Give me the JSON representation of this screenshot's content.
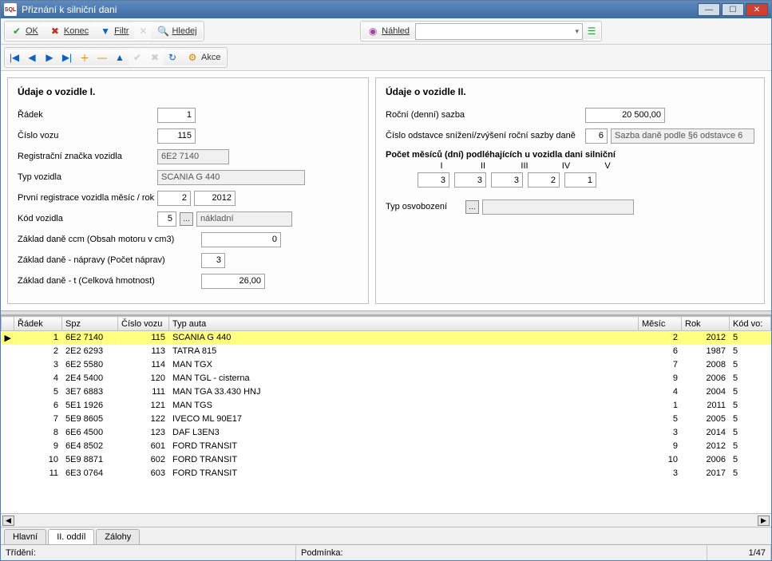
{
  "window": {
    "title": "Přiznání k silniční dani",
    "app_icon_text": "SQL"
  },
  "toolbar1": {
    "ok": "OK",
    "konec": "Konec",
    "filtr": "Filtr",
    "hledej": "Hledej",
    "nahled": "Náhled"
  },
  "toolbar2": {
    "akce": "Akce"
  },
  "panel1": {
    "heading": "Údaje o vozidle I.",
    "radek_label": "Řádek",
    "radek_value": "1",
    "cislo_vozu_label": "Číslo vozu",
    "cislo_vozu_value": "115",
    "spz_label": "Registrační značka vozidla",
    "spz_value": "6E2 7140",
    "typ_label": "Typ vozidla",
    "typ_value": "SCANIA G 440",
    "prvni_reg_label": "První registrace vozidla měsíc / rok",
    "prvni_reg_mesic": "2",
    "prvni_reg_rok": "2012",
    "kod_label": "Kód vozidla",
    "kod_value": "5",
    "kod_text": "nákladní",
    "zaklad_ccm_label": "Základ daně ccm (Obsah motoru v cm3)",
    "zaklad_ccm_value": "0",
    "zaklad_napravy_label": "Základ daně - nápravy (Počet náprav)",
    "zaklad_napravy_value": "3",
    "zaklad_t_label": "Základ daně - t (Celková hmotnost)",
    "zaklad_t_value": "26,00"
  },
  "panel2": {
    "heading": "Údaje o vozidle II.",
    "sazba_label": "Roční (denní) sazba",
    "sazba_value": "20 500,00",
    "odstavec_label": "Číslo odstavce snížení/zvýšení roční sazby daně",
    "odstavec_value": "6",
    "odstavec_text": "Sazba daně podle §6 odstavce 6",
    "mesicu_header": "Počet měsíců (dní) podléhajících u vozidla dani silniční",
    "mesic_labels": [
      "I",
      "II",
      "III",
      "IV",
      "V"
    ],
    "mesic_values": [
      "3",
      "3",
      "3",
      "2",
      "1"
    ],
    "osvobozeni_label": "Typ osvobození"
  },
  "grid": {
    "columns": [
      "",
      "Řádek",
      "Spz",
      "Číslo vozu",
      "Typ auta",
      "Měsíc",
      "Rok",
      "Kód vo:"
    ],
    "rows": [
      {
        "sel": true,
        "r": "1",
        "spz": "6E2 7140",
        "cv": "115",
        "typ": "SCANIA G 440",
        "m": "2",
        "rok": "2012",
        "k": "5"
      },
      {
        "sel": false,
        "r": "2",
        "spz": "2E2 6293",
        "cv": "113",
        "typ": "TATRA 815",
        "m": "6",
        "rok": "1987",
        "k": "5"
      },
      {
        "sel": false,
        "r": "3",
        "spz": "6E2 5580",
        "cv": "114",
        "typ": "MAN TGX",
        "m": "7",
        "rok": "2008",
        "k": "5"
      },
      {
        "sel": false,
        "r": "4",
        "spz": "2E4 5400",
        "cv": "120",
        "typ": "MAN TGL - cisterna",
        "m": "9",
        "rok": "2006",
        "k": "5"
      },
      {
        "sel": false,
        "r": "5",
        "spz": "3E7 6883",
        "cv": "111",
        "typ": "MAN TGA 33.430 HNJ",
        "m": "4",
        "rok": "2004",
        "k": "5"
      },
      {
        "sel": false,
        "r": "6",
        "spz": "5E1 1926",
        "cv": "121",
        "typ": "MAN TGS",
        "m": "1",
        "rok": "2011",
        "k": "5"
      },
      {
        "sel": false,
        "r": "7",
        "spz": "5E9 8605",
        "cv": "122",
        "typ": "IVECO ML 90E17",
        "m": "5",
        "rok": "2005",
        "k": "5"
      },
      {
        "sel": false,
        "r": "8",
        "spz": "6E6 4500",
        "cv": "123",
        "typ": "DAF L3EN3",
        "m": "3",
        "rok": "2014",
        "k": "5"
      },
      {
        "sel": false,
        "r": "9",
        "spz": "6E4 8502",
        "cv": "601",
        "typ": "FORD TRANSIT",
        "m": "9",
        "rok": "2012",
        "k": "5"
      },
      {
        "sel": false,
        "r": "10",
        "spz": "5E9 8871",
        "cv": "602",
        "typ": "FORD TRANSIT",
        "m": "10",
        "rok": "2006",
        "k": "5"
      },
      {
        "sel": false,
        "r": "11",
        "spz": "6E3 0764",
        "cv": "603",
        "typ": "FORD TRANSIT",
        "m": "3",
        "rok": "2017",
        "k": "5"
      }
    ]
  },
  "tabs": {
    "items": [
      "Hlavní",
      "II. oddíl",
      "Zálohy"
    ],
    "active": 1
  },
  "status": {
    "trideni_label": "Třídění:",
    "podminka_label": "Podmínka:",
    "position": "1/47"
  }
}
